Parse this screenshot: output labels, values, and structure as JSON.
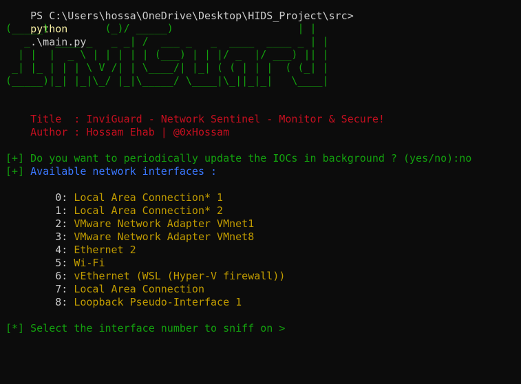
{
  "prompt": {
    "path": "PS C:\\Users\\hossa\\OneDrive\\Desktop\\HIDS_Project\\src>",
    "command": "python",
    "args": ".\\main.py"
  },
  "banner": [
    "(_____)         (_)/ _____)                    | |",
    "   _    ____ _   _ _| /  ___ _   _  ____  ____ _ | |",
    "  | |  |  _ \\ | | | | | (___) | | |/ _  |/ ___) || |",
    " _| |_ | | | \\ V /| | \\____/| |_| ( ( | | |  ( (_| |",
    "(_____)|_| |_|\\_/ |_|\\_____/ \\____|\\_||_|_|   \\____|"
  ],
  "info": {
    "title_label": "    Title  : ",
    "title_value": "InviGuard - Network Sentinel - Monitor & Secure!",
    "author_label": "    Author : ",
    "author_value": "Hossam Ehab | @0xHossam"
  },
  "question": {
    "prefix": "[+]",
    "text": " Do you want to periodically update the IOCs in background ? (yes/no):",
    "answer": "no"
  },
  "interfaces_header": {
    "prefix": "[+]",
    "text": " Available network interfaces :"
  },
  "interfaces": [
    {
      "index": "        0: ",
      "name": "Local Area Connection* 1"
    },
    {
      "index": "        1: ",
      "name": "Local Area Connection* 2"
    },
    {
      "index": "        2: ",
      "name": "VMware Network Adapter VMnet1"
    },
    {
      "index": "        3: ",
      "name": "VMware Network Adapter VMnet8"
    },
    {
      "index": "        4: ",
      "name": "Ethernet 2"
    },
    {
      "index": "        5: ",
      "name": "Wi-Fi"
    },
    {
      "index": "        6: ",
      "name": "vEthernet (WSL (Hyper-V firewall))"
    },
    {
      "index": "        7: ",
      "name": "Local Area Connection"
    },
    {
      "index": "        8: ",
      "name": "Loopback Pseudo-Interface 1"
    }
  ],
  "select_prompt": {
    "prefix": "[*]",
    "text": " Select the interface number to sniff on >"
  }
}
